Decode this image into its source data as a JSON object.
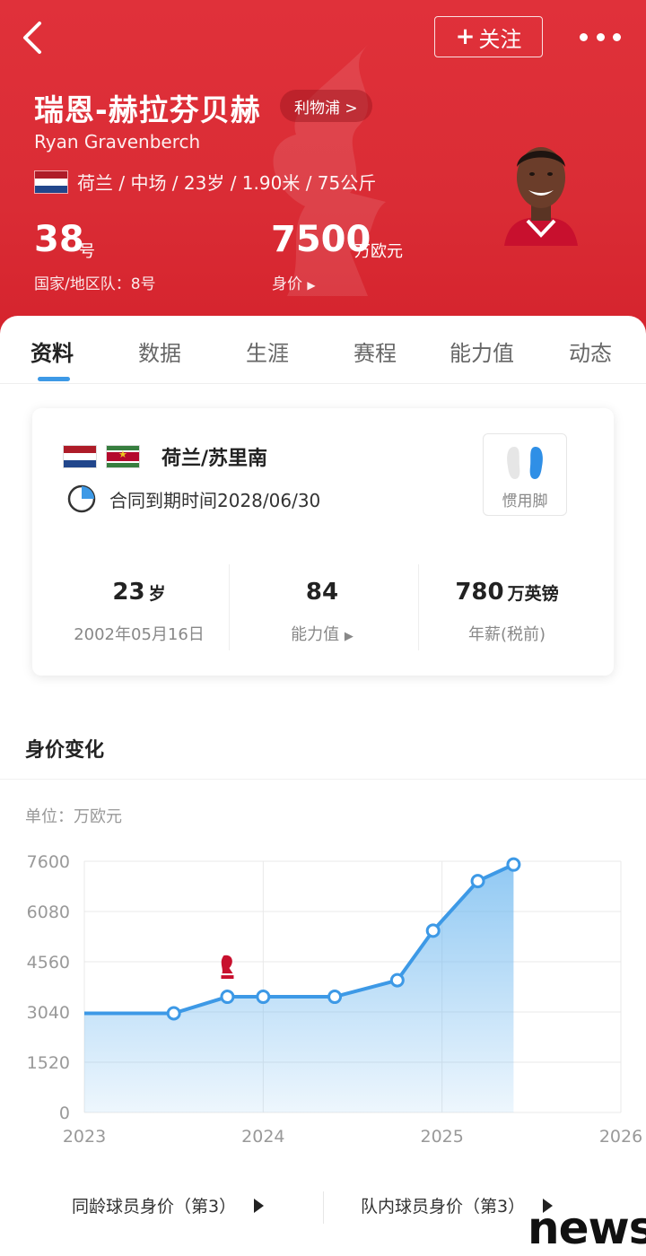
{
  "header": {
    "follow_label": "关注",
    "name_cn": "瑞恩-赫拉芬贝赫",
    "club": "利物浦 >",
    "name_en": "Ryan Gravenberch",
    "info": "荷兰 / 中场 / 23岁 / 1.90米 / 75公斤",
    "shirt_number": "38",
    "shirt_unit": "号",
    "national_team": "国家/地区队：8号",
    "market_value": "7500",
    "market_value_unit": "万欧元",
    "market_value_label": "身价"
  },
  "tabs": [
    "资料",
    "数据",
    "生涯",
    "赛程",
    "能力值",
    "动态"
  ],
  "profile": {
    "nationality": "荷兰/苏里南",
    "contract": "合同到期时间2028/06/30",
    "foot_label": "惯用脚",
    "age_value": "23",
    "age_unit": "岁",
    "birth_date": "2002年05月16日",
    "rating_value": "84",
    "rating_label": "能力值",
    "wage_value": "780",
    "wage_unit": "万英镑",
    "wage_label": "年薪(税前)"
  },
  "section": {
    "title": "身价变化",
    "unit_label": "单位：万欧元"
  },
  "chart_data": {
    "type": "area",
    "x_ticks": [
      "2023",
      "2024",
      "2025",
      "2026"
    ],
    "y_ticks": [
      "7600",
      "6080",
      "4560",
      "3040",
      "1520",
      "0"
    ],
    "ylim": [
      0,
      7600
    ],
    "xlim": [
      2023,
      2026
    ],
    "x": [
      2023.0,
      2023.5,
      2023.8,
      2024.0,
      2024.4,
      2024.75,
      2024.95,
      2025.2,
      2025.4
    ],
    "values": [
      3000,
      3000,
      3500,
      3500,
      3500,
      4000,
      5500,
      7000,
      7500
    ],
    "markers_from_index": 1,
    "line_color": "#3d99e6",
    "fill_color": "#6db7ef",
    "transfer_marker_year": 2023.8
  },
  "bottom": {
    "age_rank": "同龄球员身价（第3）",
    "team_rank": "队内球员身价（第3）"
  },
  "watermark": "news"
}
